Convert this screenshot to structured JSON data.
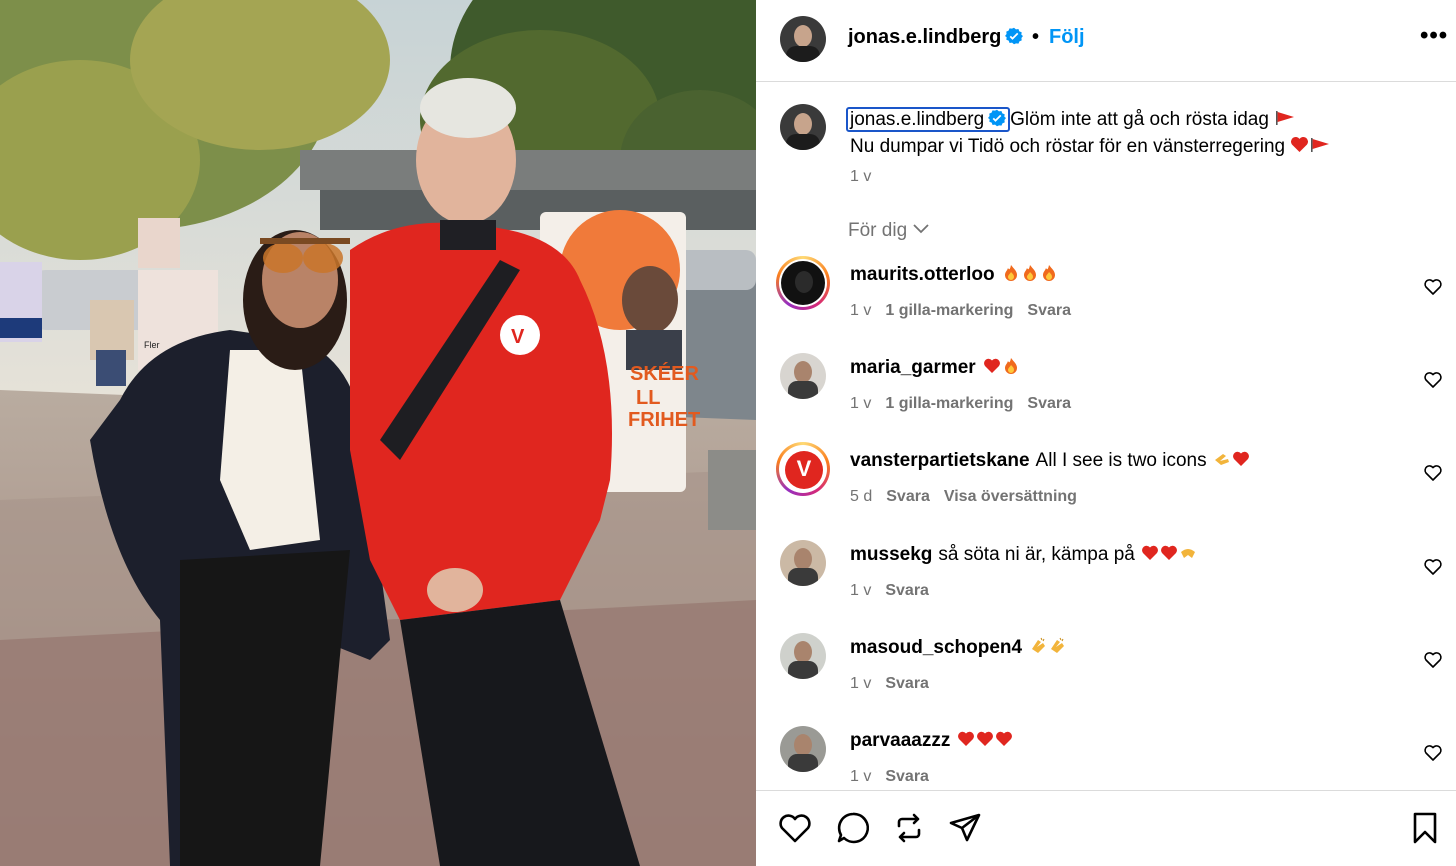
{
  "post": {
    "author": "jonas.e.lindberg",
    "separator": "•",
    "follow_label": "Följ",
    "more_label": "•••"
  },
  "caption": {
    "user": "jonas.e.lindberg",
    "line1": "Glöm inte att gå och rösta idag",
    "line2": "Nu dumpar vi Tidö och röstar för en vänsterregering",
    "time": "1 v"
  },
  "sort": {
    "label": "För dig"
  },
  "comments": [
    {
      "user": "maurits.otterloo",
      "text": "",
      "emoji": [
        "fire",
        "fire",
        "fire"
      ],
      "time": "1 v",
      "likes": "1 gilla-markering",
      "reply": "Svara",
      "extra": ""
    },
    {
      "user": "maria_garmer",
      "text": "",
      "emoji": [
        "heart",
        "fire"
      ],
      "time": "1 v",
      "likes": "1 gilla-markering",
      "reply": "Svara",
      "extra": ""
    },
    {
      "user": "vansterpartietskane",
      "text": "All I see is two icons",
      "emoji": [
        "hand",
        "heart"
      ],
      "time": "5 d",
      "likes": "",
      "reply": "Svara",
      "extra": "Visa översättning"
    },
    {
      "user": "mussekg",
      "text": "så söta ni är, kämpa på",
      "emoji": [
        "heart",
        "heart",
        "hands"
      ],
      "time": "1 v",
      "likes": "",
      "reply": "Svara",
      "extra": ""
    },
    {
      "user": "masoud_schopen4",
      "text": "",
      "emoji": [
        "clap",
        "clap"
      ],
      "time": "1 v",
      "likes": "",
      "reply": "Svara",
      "extra": ""
    },
    {
      "user": "parvaaazzz",
      "text": "",
      "emoji": [
        "heart",
        "heart",
        "heart"
      ],
      "time": "1 v",
      "likes": "",
      "reply": "Svara",
      "extra": ""
    }
  ],
  "photo_signs": {
    "poster_line1": "SKÉER",
    "poster_line2": "LL",
    "poster_line3": "FRIHET",
    "jacket_logo": "V",
    "left_sign": "Fler"
  },
  "colors": {
    "follow": "#0095f6",
    "muted": "#737373",
    "jacket": "#e0261f",
    "verified": "#0095f6"
  }
}
